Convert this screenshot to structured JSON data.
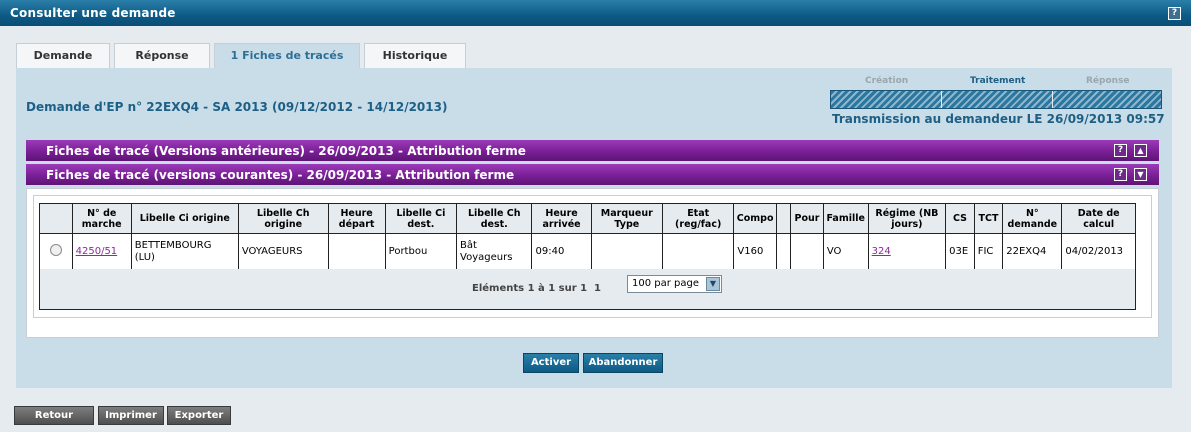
{
  "window": {
    "title": "Consulter une demande",
    "help": "?"
  },
  "tabs": [
    "Demande",
    "Réponse",
    "1 Fiches de tracés",
    "Historique"
  ],
  "demand_title": "Demande d'EP n° 22EXQ4 - SA 2013 (09/12/2012 - 14/12/2013)",
  "steps": [
    "Création",
    "Traitement",
    "Réponse"
  ],
  "transmission": "Transmission au demandeur LE 26/09/2013 09:57",
  "sections": [
    {
      "label": "Fiches de tracé (Versions antérieures) - 26/09/2013 - Attribution ferme",
      "help": "?",
      "toggle": "▲"
    },
    {
      "label": "Fiches de tracé (versions courantes) - 26/09/2013 - Attribution ferme",
      "help": "?",
      "toggle": "▼"
    }
  ],
  "table": {
    "headers": [
      "",
      "N° de marche",
      "Libelle Ci origine",
      "Libelle Ch origine",
      "Heure départ",
      "Libelle Ci dest.",
      "Libelle Ch dest.",
      "Heure arrivée",
      "Marqueur Type",
      "Etat (reg/fac)",
      "Compo",
      "",
      "Pour",
      "Famille",
      "Régime (NB jours)",
      "CS",
      "TCT",
      "N° demande",
      "Date de calcul"
    ],
    "row": {
      "marche": "4250/51",
      "ci_origine": "BETTEMBOURG (LU)",
      "ch_origine": "VOYAGEURS",
      "heure_depart": "",
      "ci_dest": "Portbou",
      "ch_dest": "Bât Voyageurs",
      "heure_arrivee": "09:40",
      "marqueur": "",
      "etat": "",
      "compo": "V160",
      "blank": "",
      "pour": "",
      "famille": "VO",
      "regime": "324",
      "cs": "03E",
      "tct": "FIC",
      "demande": "22EXQ4",
      "date_calcul": "04/02/2013"
    }
  },
  "pager": {
    "info": "Eléments 1 à 1 sur 1",
    "page": "1",
    "per_page": "100 par page"
  },
  "actions": {
    "activer": "Activer",
    "abandonner": "Abandonner"
  },
  "footer": {
    "retour": "Retour",
    "imprimer": "Imprimer",
    "exporter": "Exporter"
  }
}
